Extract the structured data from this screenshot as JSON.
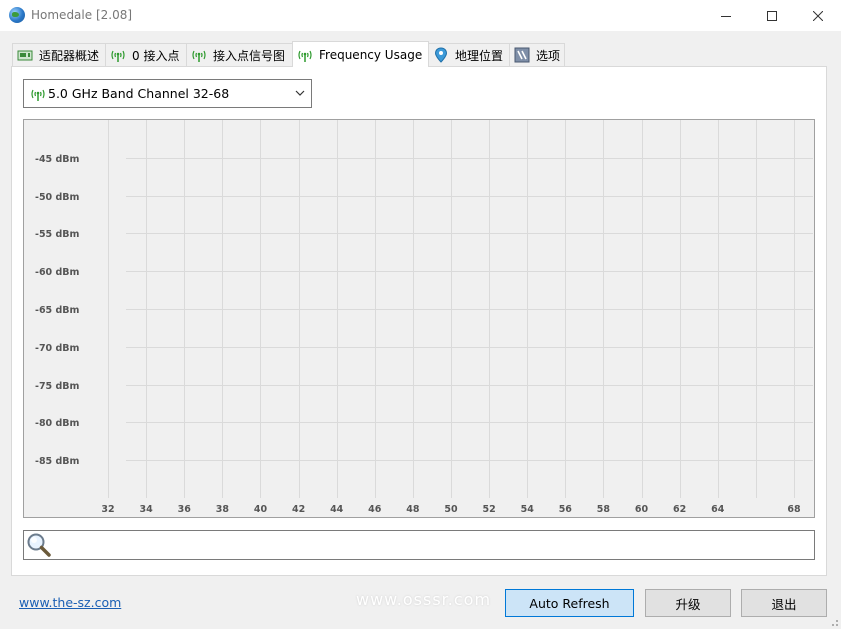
{
  "window": {
    "title": "Homedale [2.08]",
    "controls": {
      "minimize": "—",
      "maximize": "☐",
      "close": "✕"
    }
  },
  "tabs": [
    {
      "label": "适配器概述",
      "icon": "network-card-icon",
      "active": false
    },
    {
      "label": "0 接入点",
      "icon": "antenna-icon",
      "active": false
    },
    {
      "label": "接入点信号图",
      "icon": "antenna-icon",
      "active": false
    },
    {
      "label": "Frequency Usage",
      "icon": "antenna-icon",
      "active": true
    },
    {
      "label": "地理位置",
      "icon": "location-pin-icon",
      "active": false
    },
    {
      "label": "选项",
      "icon": "options-icon",
      "active": false
    }
  ],
  "band_select": {
    "value": "5.0 GHz Band Channel 32-68",
    "icon": "antenna-icon"
  },
  "chart_data": {
    "type": "line",
    "title": "",
    "xlabel": "",
    "ylabel": "",
    "series": [],
    "x_ticks": [
      32,
      34,
      36,
      38,
      40,
      42,
      44,
      46,
      48,
      50,
      52,
      54,
      56,
      58,
      60,
      62,
      64,
      68
    ],
    "y_ticks": [
      "-45 dBm",
      "-50 dBm",
      "-55 dBm",
      "-60 dBm",
      "-65 dBm",
      "-70 dBm",
      "-75 dBm",
      "-80 dBm",
      "-85 dBm"
    ],
    "y_values": [
      -45,
      -50,
      -55,
      -60,
      -65,
      -70,
      -75,
      -80,
      -85
    ],
    "xlim": [
      31,
      69
    ],
    "ylim": [
      -90,
      -40
    ],
    "grid": true,
    "colors": {
      "background": "#f0f0f0",
      "grid": "#dadada",
      "label": "#555555"
    }
  },
  "search": {
    "value": "",
    "icon": "magnifier-icon"
  },
  "footer": {
    "link": "www.the-sz.com",
    "watermark": "www.osssr.com",
    "auto_refresh": "Auto Refresh",
    "upgrade": "升级",
    "exit": "退出"
  },
  "colors": {
    "accent": "#0078d7",
    "link": "#1a5fb4",
    "antenna_green": "#2e9a2e"
  }
}
